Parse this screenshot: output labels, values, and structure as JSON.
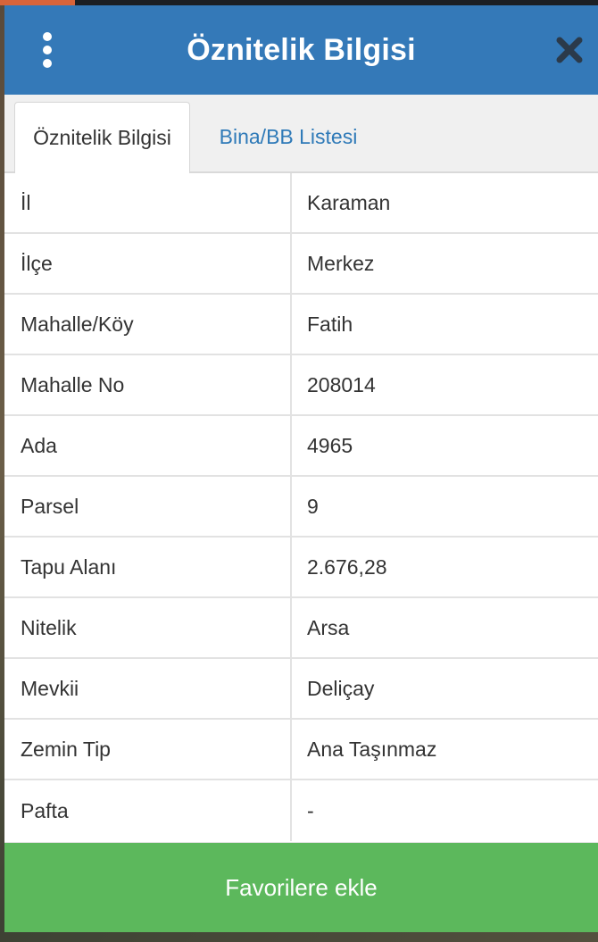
{
  "header": {
    "title": "Öznitelik Bilgisi",
    "menu_icon": "vertical-dots-icon",
    "close_icon": "close-icon"
  },
  "tabs": [
    {
      "label": "Öznitelik Bilgisi",
      "active": true
    },
    {
      "label": "Bina/BB Listesi",
      "active": false
    }
  ],
  "attributes": [
    {
      "key": "İl",
      "value": "Karaman"
    },
    {
      "key": "İlçe",
      "value": "Merkez"
    },
    {
      "key": "Mahalle/Köy",
      "value": "Fatih"
    },
    {
      "key": "Mahalle No",
      "value": "208014"
    },
    {
      "key": "Ada",
      "value": "4965"
    },
    {
      "key": "Parsel",
      "value": "9"
    },
    {
      "key": "Tapu Alanı",
      "value": "2.676,28"
    },
    {
      "key": "Nitelik",
      "value": "Arsa"
    },
    {
      "key": "Mevkii",
      "value": "Deliçay"
    },
    {
      "key": "Zemin Tip",
      "value": "Ana Taşınmaz"
    },
    {
      "key": "Pafta",
      "value": "-"
    }
  ],
  "footer": {
    "favorite_label": "Favorilere ekle"
  },
  "colors": {
    "header_bg": "#3479b8",
    "button_bg": "#5cb85c",
    "tab_link": "#2f7ab8"
  }
}
